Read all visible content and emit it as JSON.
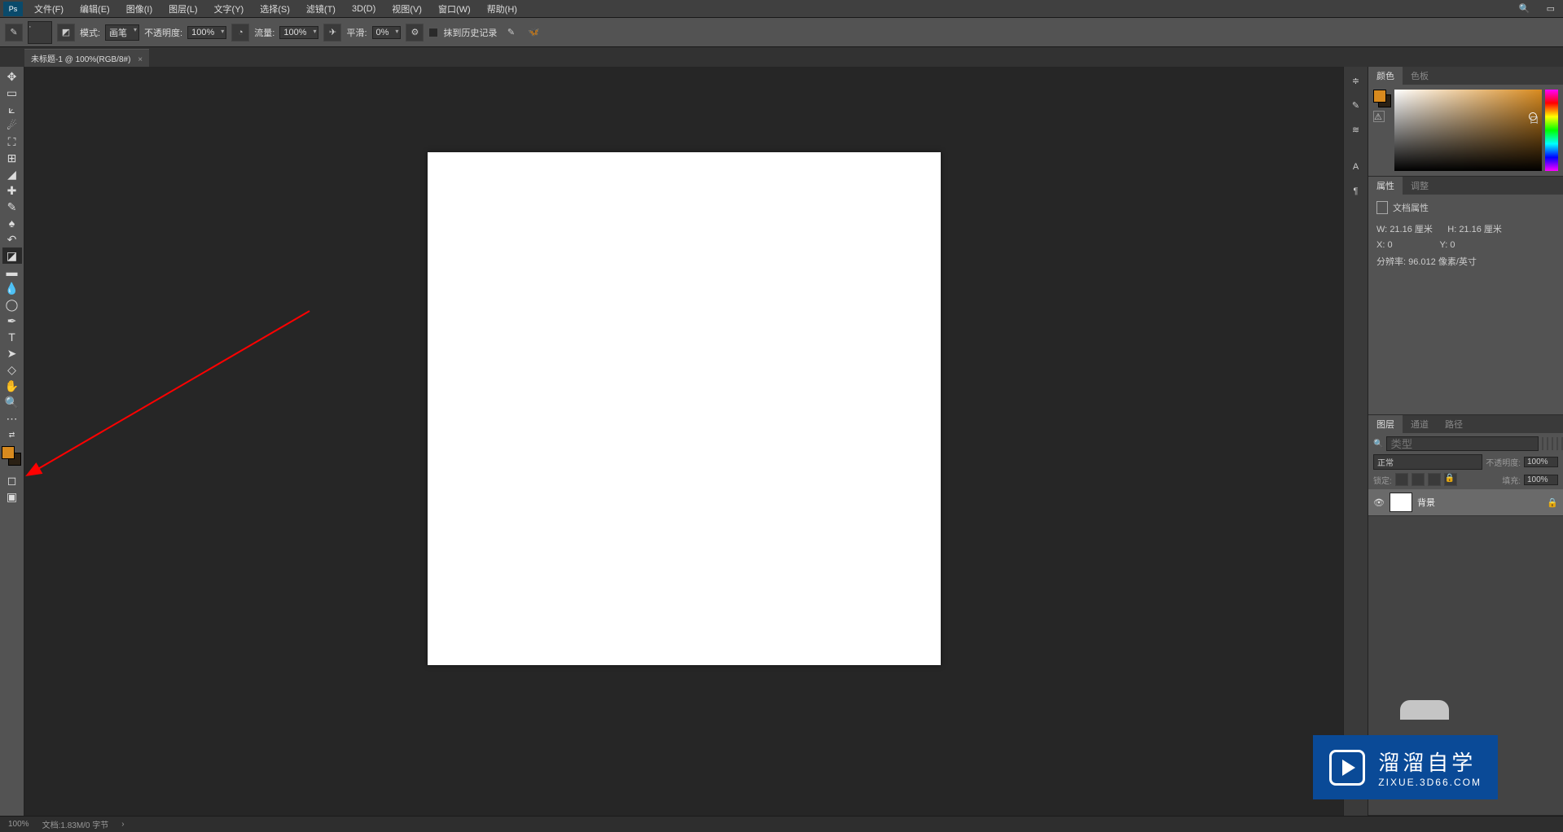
{
  "menu": {
    "items": [
      "文件(F)",
      "编辑(E)",
      "图像(I)",
      "图层(L)",
      "文字(Y)",
      "选择(S)",
      "滤镜(T)",
      "3D(D)",
      "视图(V)",
      "窗口(W)",
      "帮助(H)"
    ]
  },
  "options": {
    "mode_label": "模式:",
    "mode_value": "画笔",
    "opacity_label": "不透明度:",
    "opacity_value": "100%",
    "flow_label": "流量:",
    "flow_value": "100%",
    "smoothing_label": "平滑:",
    "smoothing_value": "0%",
    "history_label": "抹到历史记录"
  },
  "tab": {
    "title": "未标题-1 @ 100%(RGB/8#)",
    "close": "×"
  },
  "panels": {
    "color_tabs": [
      "颜色",
      "色板"
    ],
    "props_tabs": [
      "属性",
      "调整"
    ],
    "layers_tabs": [
      "图层",
      "通道",
      "路径"
    ]
  },
  "props": {
    "title": "文档属性",
    "w_label": "W:",
    "w_value": "21.16 厘米",
    "h_label": "H:",
    "h_value": "21.16 厘米",
    "x_label": "X:",
    "x_value": "0",
    "y_label": "Y:",
    "y_value": "0",
    "res_label": "分辨率:",
    "res_value": "96.012 像素/英寸"
  },
  "layers": {
    "search_placeholder": "类型",
    "blend_mode": "正常",
    "opacity_label": "不透明度:",
    "opacity_value": "100%",
    "lock_label": "锁定:",
    "fill_label": "填充:",
    "fill_value": "100%",
    "layer_name": "背景"
  },
  "status": {
    "zoom": "100%",
    "doc": "文档:1.83M/0 字节"
  },
  "colors": {
    "fg": "#d88a1e",
    "bg": "#2a2014"
  },
  "watermark": {
    "title": "溜溜自学",
    "url": "ZIXUE.3D66.COM"
  },
  "color_marker": "口"
}
